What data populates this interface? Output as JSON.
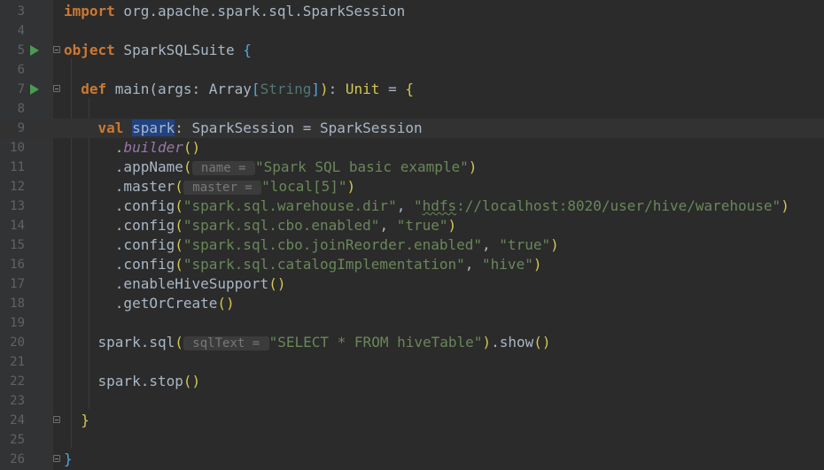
{
  "editor": {
    "lines": [
      {
        "num": "3",
        "parts": [
          {
            "t": "import",
            "c": "kw"
          },
          {
            "t": " org.apache.spark.sql.SparkSession",
            "c": ""
          }
        ]
      },
      {
        "num": "4",
        "parts": []
      },
      {
        "num": "5",
        "run": true,
        "fold": true,
        "parts": [
          {
            "t": "object",
            "c": "kw"
          },
          {
            "t": " SparkSQLSuite ",
            "c": ""
          },
          {
            "t": "{",
            "c": "brace-2"
          }
        ]
      },
      {
        "num": "6",
        "parts": []
      },
      {
        "num": "7",
        "run": true,
        "fold": true,
        "parts": [
          {
            "t": "  def ",
            "c": "kw"
          },
          {
            "t": "main",
            "c": "fn"
          },
          {
            "t": "(args: Array",
            "c": ""
          },
          {
            "t": "[",
            "c": "brace-2"
          },
          {
            "t": "String",
            "c": "type-param"
          },
          {
            "t": "]",
            "c": "brace-2"
          },
          {
            "t": ")",
            "c": "brace-1"
          },
          {
            "t": ": ",
            "c": ""
          },
          {
            "t": "Unit",
            "c": "brace-1"
          },
          {
            "t": " = ",
            "c": ""
          },
          {
            "t": "{",
            "c": "brace-1"
          }
        ]
      },
      {
        "num": "8",
        "parts": []
      },
      {
        "num": "9",
        "current": true,
        "parts": [
          {
            "t": "    val ",
            "c": "kw"
          },
          {
            "t": "spark",
            "c": "sel"
          },
          {
            "t": ": SparkSession = SparkSession",
            "c": ""
          }
        ]
      },
      {
        "num": "10",
        "parts": [
          {
            "t": "      .",
            "c": ""
          },
          {
            "t": "builder",
            "c": "ital"
          },
          {
            "t": "()",
            "c": "brace-1"
          }
        ]
      },
      {
        "num": "11",
        "parts": [
          {
            "t": "      .appName",
            "c": ""
          },
          {
            "t": "(",
            "c": "brace-1"
          },
          {
            "t": " name = ",
            "c": "hint"
          },
          {
            "t": "\"Spark SQL basic example\"",
            "c": "str"
          },
          {
            "t": ")",
            "c": "brace-1"
          }
        ]
      },
      {
        "num": "12",
        "parts": [
          {
            "t": "      .master",
            "c": ""
          },
          {
            "t": "(",
            "c": "brace-1"
          },
          {
            "t": " master = ",
            "c": "hint"
          },
          {
            "t": "\"local[5]\"",
            "c": "str"
          },
          {
            "t": ")",
            "c": "brace-1"
          }
        ]
      },
      {
        "num": "13",
        "parts": [
          {
            "t": "      .config",
            "c": ""
          },
          {
            "t": "(",
            "c": "brace-1"
          },
          {
            "t": "\"spark.sql.warehouse.dir\"",
            "c": "str"
          },
          {
            "t": ", ",
            "c": ""
          },
          {
            "t": "\"",
            "c": "str"
          },
          {
            "t": "hdfs",
            "c": "str squiggle"
          },
          {
            "t": "://localhost:8020/user/hive/warehouse\"",
            "c": "str"
          },
          {
            "t": ")",
            "c": "brace-1"
          }
        ]
      },
      {
        "num": "14",
        "parts": [
          {
            "t": "      .config",
            "c": ""
          },
          {
            "t": "(",
            "c": "brace-1"
          },
          {
            "t": "\"spark.sql.cbo.enabled\"",
            "c": "str"
          },
          {
            "t": ", ",
            "c": ""
          },
          {
            "t": "\"true\"",
            "c": "str"
          },
          {
            "t": ")",
            "c": "brace-1"
          }
        ]
      },
      {
        "num": "15",
        "parts": [
          {
            "t": "      .config",
            "c": ""
          },
          {
            "t": "(",
            "c": "brace-1"
          },
          {
            "t": "\"spark.sql.cbo.joinReorder.enabled\"",
            "c": "str"
          },
          {
            "t": ", ",
            "c": ""
          },
          {
            "t": "\"true\"",
            "c": "str"
          },
          {
            "t": ")",
            "c": "brace-1"
          }
        ]
      },
      {
        "num": "16",
        "parts": [
          {
            "t": "      .config",
            "c": ""
          },
          {
            "t": "(",
            "c": "brace-1"
          },
          {
            "t": "\"spark.sql.catalogImplementation\"",
            "c": "str"
          },
          {
            "t": ", ",
            "c": ""
          },
          {
            "t": "\"hive\"",
            "c": "str"
          },
          {
            "t": ")",
            "c": "brace-1"
          }
        ]
      },
      {
        "num": "17",
        "parts": [
          {
            "t": "      .enableHiveSupport",
            "c": ""
          },
          {
            "t": "()",
            "c": "brace-1"
          }
        ]
      },
      {
        "num": "18",
        "parts": [
          {
            "t": "      .getOrCreate",
            "c": ""
          },
          {
            "t": "()",
            "c": "brace-1"
          }
        ]
      },
      {
        "num": "19",
        "parts": []
      },
      {
        "num": "20",
        "parts": [
          {
            "t": "    ",
            "c": ""
          },
          {
            "t": "spark",
            "c": "obj"
          },
          {
            "t": ".sql",
            "c": ""
          },
          {
            "t": "(",
            "c": "brace-1"
          },
          {
            "t": " sqlText = ",
            "c": "hint"
          },
          {
            "t": "\"SELECT * FROM hiveTable\"",
            "c": "str"
          },
          {
            "t": ")",
            "c": "brace-1"
          },
          {
            "t": ".show",
            "c": ""
          },
          {
            "t": "()",
            "c": "brace-1"
          }
        ]
      },
      {
        "num": "21",
        "parts": []
      },
      {
        "num": "22",
        "parts": [
          {
            "t": "    ",
            "c": ""
          },
          {
            "t": "spark",
            "c": "obj"
          },
          {
            "t": ".stop",
            "c": ""
          },
          {
            "t": "()",
            "c": "brace-1"
          }
        ]
      },
      {
        "num": "23",
        "parts": []
      },
      {
        "num": "24",
        "fold": true,
        "parts": [
          {
            "t": "  ",
            "c": ""
          },
          {
            "t": "}",
            "c": "brace-1"
          }
        ]
      },
      {
        "num": "25",
        "parts": []
      },
      {
        "num": "26",
        "fold": true,
        "parts": [
          {
            "t": "}",
            "c": "brace-2"
          }
        ]
      }
    ]
  }
}
